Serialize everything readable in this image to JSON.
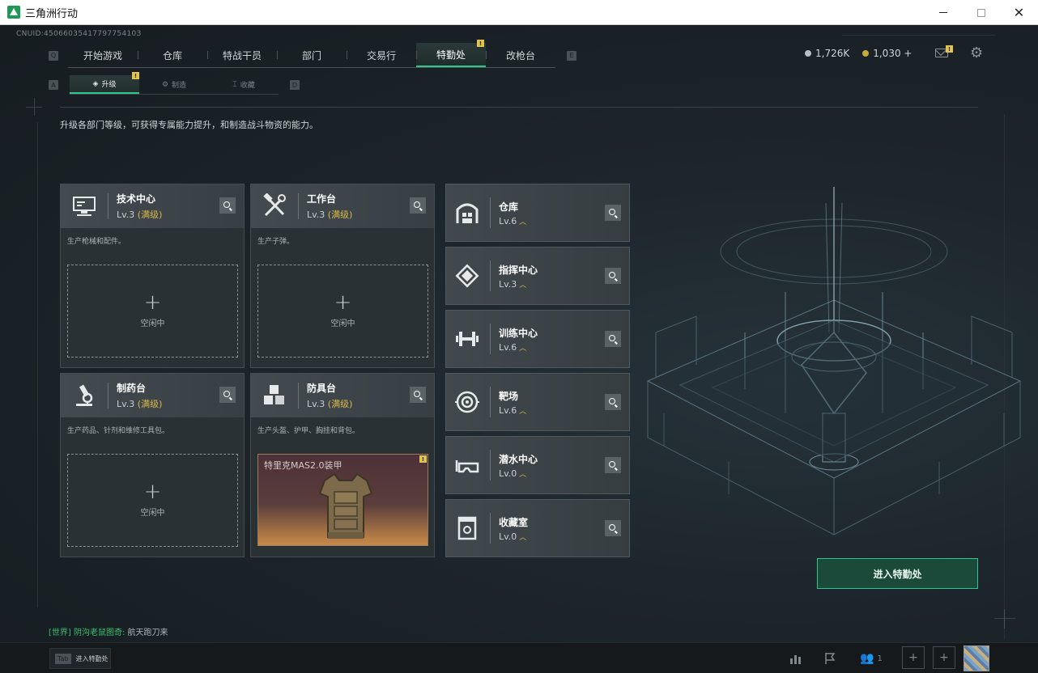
{
  "window": {
    "title": "三角洲行动"
  },
  "header": {
    "uid": "CNUID:4506603541779775410З"
  },
  "nav": {
    "left_key": "Q",
    "right_key": "E",
    "tabs": [
      {
        "label": "开始游戏"
      },
      {
        "label": "仓库"
      },
      {
        "label": "特战干员"
      },
      {
        "label": "部门"
      },
      {
        "label": "交易行"
      },
      {
        "label": "特勤处",
        "active": true,
        "badge": "!"
      },
      {
        "label": "改枪台"
      }
    ]
  },
  "currency": {
    "silver": "1,726K",
    "gold": "1,030 +"
  },
  "mail": {
    "badge": "!"
  },
  "subnav": {
    "left_key": "A",
    "right_key": "D",
    "tabs": [
      {
        "label": "升级",
        "icon": "◈",
        "active": true,
        "badge": "!"
      },
      {
        "label": "制造",
        "icon": "⚙"
      },
      {
        "label": "收藏",
        "icon": "⌶"
      }
    ]
  },
  "description": "升级各部门等级，可获得专属能力提升，和制造战斗物资的能力。",
  "stations": [
    {
      "name": "技术中心",
      "lv": "Lv.3",
      "maxed": "(满级)",
      "desc": "生产枪械和配件。",
      "slot_plus": "+",
      "slot_status": "空闲中",
      "icon": "computer-icon"
    },
    {
      "name": "工作台",
      "lv": "Lv.3",
      "maxed": "(满级)",
      "desc": "生产子弹。",
      "slot_plus": "+",
      "slot_status": "空闲中",
      "icon": "tools-icon"
    },
    {
      "name": "制药台",
      "lv": "Lv.3",
      "maxed": "(满级)",
      "desc": "生产药品、针剂和维修工具包。",
      "slot_plus": "+",
      "slot_status": "空闲中",
      "icon": "microscope-icon"
    },
    {
      "name": "防具台",
      "lv": "Lv.3",
      "maxed": "(满级)",
      "desc": "生产头盔、护甲、胸挂和背包。",
      "slot_item": "特里克MAS2.0装甲",
      "slot_badge": "!",
      "icon": "armor-blocks-icon"
    }
  ],
  "rows": [
    {
      "name": "仓库",
      "lv": "Lv.6",
      "up": "︿",
      "icon": "warehouse-icon"
    },
    {
      "name": "指挥中心",
      "lv": "Lv.3",
      "up": "︿",
      "icon": "command-icon"
    },
    {
      "name": "训练中心",
      "lv": "Lv.6",
      "up": "︿",
      "icon": "dumbbell-icon"
    },
    {
      "name": "靶场",
      "lv": "Lv.6",
      "up": "︿",
      "icon": "target-icon"
    },
    {
      "name": "潜水中心",
      "lv": "Lv.0",
      "up": "︿",
      "icon": "goggles-icon"
    },
    {
      "name": "收藏室",
      "lv": "Lv.0",
      "up": "︿",
      "icon": "trophy-case-icon"
    }
  ],
  "enter_button": "进入特勤处",
  "chat": {
    "channel": "[世界]",
    "sender": "阴沟老鼠图奇:",
    "message": " 航天跑刀来"
  },
  "bottom": {
    "tab_key": "Tab",
    "tab_label": "进入特勤处",
    "party_count": "1",
    "plus1": "+",
    "plus2": "+"
  },
  "colors": {
    "accent": "#2fc88a",
    "maxed": "#d9b84a",
    "badge": "#e3c44a"
  }
}
